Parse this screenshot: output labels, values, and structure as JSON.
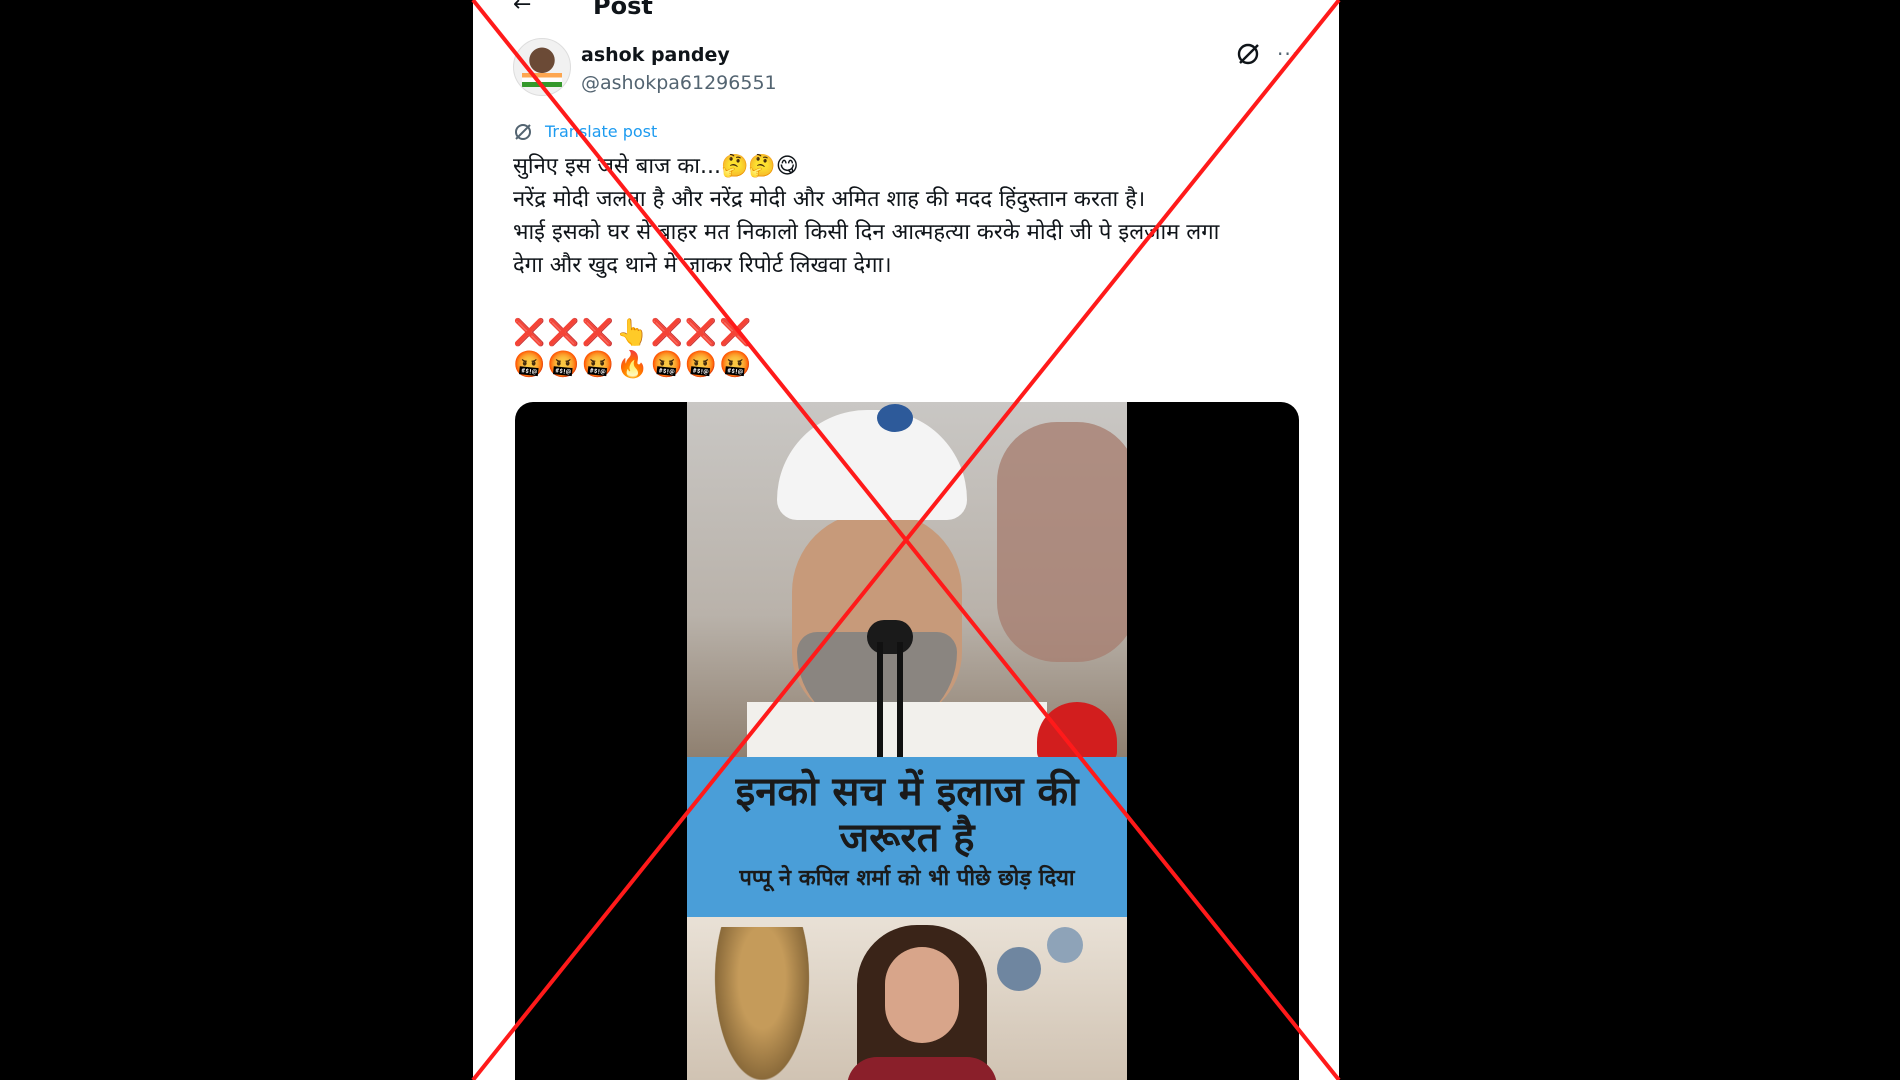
{
  "header": {
    "back_glyph": "←",
    "title": "Post"
  },
  "author": {
    "name": "ashok pandey",
    "handle": "@ashokpa61296551"
  },
  "actions": {
    "more_glyph": "···"
  },
  "translate": {
    "label": "Translate post"
  },
  "post": {
    "lines": [
      "सुनिए इस जसे बाज का...🤔🤔😋",
      "नरेंद्र मोदी जलता है और नरेंद्र मोदी और अमित शाह की मदद हिंदुस्तान करता है।",
      "भाई इसको घर से बाहर मत निकालो किसी दिन आत्महत्या करके मोदी जी पे इलजाम लगा",
      "देगा और खुद थाने में जाकर रिपोर्ट लिखवा देगा।"
    ],
    "emoji_row_1": "❌❌❌👆❌❌❌",
    "emoji_row_2": "🤬🤬🤬🔥🤬🤬🤬"
  },
  "media": {
    "caption_line_1": "इनको सच में इलाज की",
    "caption_line_2": "जरूरत है",
    "caption_line_3": "पप्पू ने कपिल शर्मा को भी पीछे छोड़ दिया"
  },
  "colors": {
    "accent": "#1d9bf0",
    "cross": "#ff1a1a",
    "caption_bg": "#4a9ed8"
  }
}
